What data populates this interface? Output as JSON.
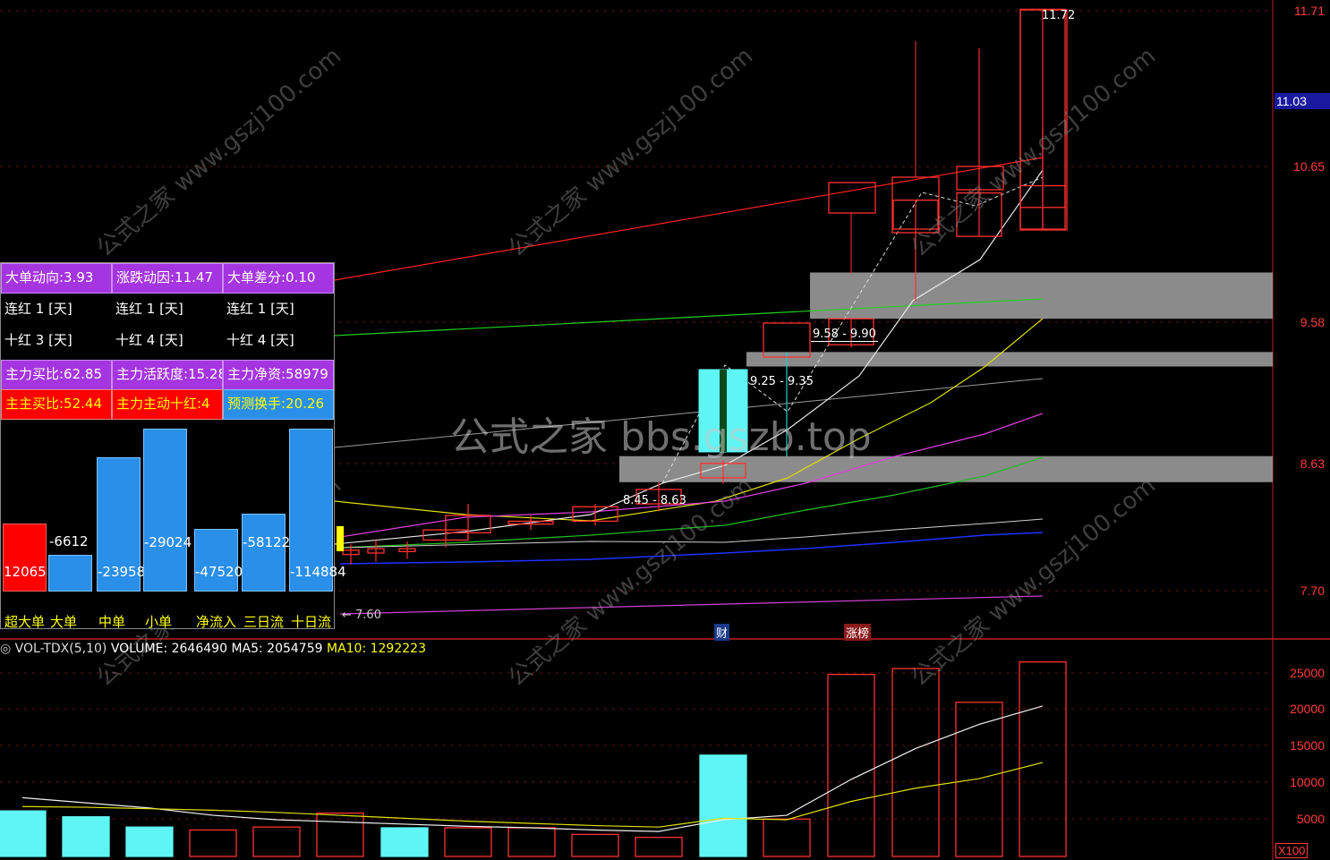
{
  "price_axis": {
    "ticks": [
      "11.71",
      "10.65",
      "9.58",
      "8.63",
      "7.70"
    ],
    "current_tag": "11.03"
  },
  "annotations": {
    "high_label": "11.72",
    "range1": "9.58 - 9.90",
    "range2": "9.25 - 9.35",
    "range3": "8.45 - 8.63",
    "low_label": "← 7.60",
    "marker_cai": "财",
    "marker_zhangbang": "涨榜"
  },
  "panel": {
    "rows": [
      [
        "大单动向:3.93",
        "涨跌动因:11.47",
        "大单差分:0.10"
      ],
      [
        "连红  1 [天]",
        "连红  1 [天]",
        "连红  1 [天]"
      ],
      [
        "十红  3 [天]",
        "十红  4 [天]",
        "十红  4 [天]"
      ],
      [
        "主力买比:62.85",
        "主力活跃度:15.28",
        "主力净资:58979"
      ],
      [
        "主主买比:52.44",
        "主力主动十红:4",
        "预测换手:20.26"
      ]
    ],
    "bars": [
      {
        "label": "超大单",
        "value": "12065",
        "amount": 12065,
        "color": "#ff0000"
      },
      {
        "label": "大单",
        "value": "-6612",
        "amount": 6612,
        "color": "#2a8fe8"
      },
      {
        "label": "中单",
        "value": "-23958",
        "amount": 23958,
        "color": "#2a8fe8"
      },
      {
        "label": "小单",
        "value": "-29024",
        "amount": 29024,
        "color": "#2a8fe8"
      },
      {
        "label": "净流入",
        "value": "-47520",
        "amount": 11200,
        "color": "#2a8fe8"
      },
      {
        "label": "三日流",
        "value": "-58122",
        "amount": 13800,
        "color": "#2a8fe8"
      },
      {
        "label": "十日流",
        "value": "-114884",
        "amount": 29024,
        "color": "#2a8fe8"
      }
    ]
  },
  "volume_header": {
    "name": "VOL-TDX(5,10)",
    "volume": "VOLUME: 2646490",
    "ma5": "MA5: 2054759",
    "ma10": "MA10: 1292223"
  },
  "volume_axis": {
    "ticks": [
      "25000",
      "20000",
      "15000",
      "10000",
      "5000"
    ],
    "unit": "X100"
  },
  "watermark": {
    "center": "公式之家 bbs.gszb.top",
    "small": "公式之家 www.gszj100.com"
  },
  "chart_data": {
    "type": "candlestick",
    "ylim": [
      7.4,
      11.8
    ],
    "candles": [
      {
        "o": 7.95,
        "h": 8.02,
        "l": 7.88,
        "c": 7.98,
        "up": false
      },
      {
        "o": 7.96,
        "h": 8.05,
        "l": 7.9,
        "c": 7.99,
        "up": false
      },
      {
        "o": 7.97,
        "h": 8.04,
        "l": 7.92,
        "c": 7.99,
        "up": false
      },
      {
        "o": 8.05,
        "h": 8.15,
        "l": 8.0,
        "c": 8.12,
        "up": true
      },
      {
        "o": 8.1,
        "h": 8.3,
        "l": 8.06,
        "c": 8.22,
        "up": true
      },
      {
        "o": 8.16,
        "h": 8.22,
        "l": 8.12,
        "c": 8.18,
        "up": false
      },
      {
        "o": 8.18,
        "h": 8.3,
        "l": 8.15,
        "c": 8.28,
        "up": true
      },
      {
        "o": 8.3,
        "h": 8.45,
        "l": 8.25,
        "c": 8.4,
        "up": false
      },
      {
        "o": 8.48,
        "h": 8.6,
        "l": 8.44,
        "c": 8.58,
        "up": false
      },
      {
        "o": 9.35,
        "h": 9.35,
        "l": 8.63,
        "c": 8.85,
        "up": false
      },
      {
        "o": 9.4,
        "h": 9.58,
        "l": 9.38,
        "c": 9.58,
        "up": true
      },
      {
        "o": 10.2,
        "h": 10.4,
        "l": 9.7,
        "c": 10.4,
        "up": true
      },
      {
        "o": 10.15,
        "h": 11.45,
        "l": 10.15,
        "c": 10.45,
        "up": true
      },
      {
        "o": 10.35,
        "h": 10.9,
        "l": 10.2,
        "c": 10.5,
        "up": true
      },
      {
        "o": 10.2,
        "h": 11.72,
        "l": 10.2,
        "c": 11.72,
        "up": true
      }
    ],
    "volumes": [
      6200,
      5400,
      4000,
      3600,
      4000,
      5900,
      3900,
      3900,
      3900,
      3000,
      2600,
      13800,
      5100,
      24800,
      25600,
      21000,
      26500
    ],
    "ma5": [
      8000,
      7300,
      6600,
      5600,
      5000,
      4700,
      4400,
      4100,
      3900,
      3600,
      3400,
      5000,
      5600,
      10500,
      14700,
      18000,
      20500
    ],
    "ma10": [
      6800,
      6700,
      6500,
      6300,
      6000,
      5600,
      5200,
      4800,
      4500,
      4200,
      4000,
      5200,
      5000,
      7500,
      9300,
      10600,
      12800
    ],
    "zones": [
      {
        "top": 9.9,
        "bottom": 9.58
      },
      {
        "top": 9.35,
        "bottom": 9.25
      },
      {
        "top": 8.63,
        "bottom": 8.45
      }
    ]
  }
}
